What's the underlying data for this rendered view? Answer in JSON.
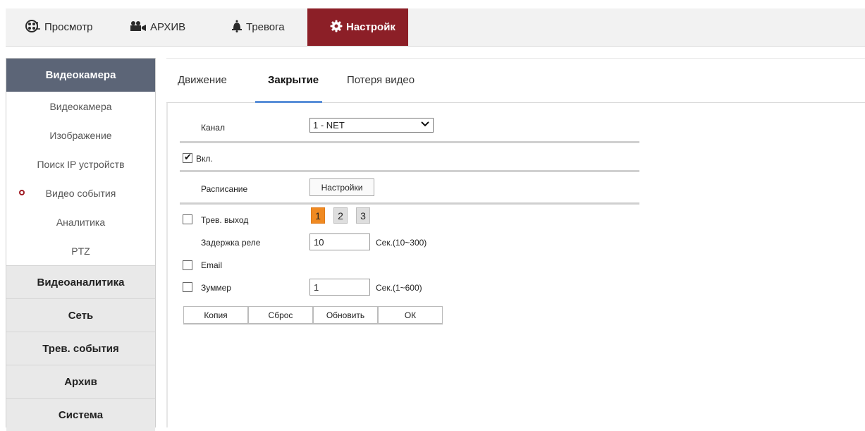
{
  "topnav": {
    "preview": "Просмотр",
    "archive": "АРХИВ",
    "alarm": "Тревога",
    "settings": "Настройк"
  },
  "sidebar": {
    "header": "Видеокамера",
    "items": [
      {
        "label": "Видеокамера"
      },
      {
        "label": "Изображение"
      },
      {
        "label": "Поиск IP устройств"
      },
      {
        "label": "Видео события"
      },
      {
        "label": "Аналитика"
      },
      {
        "label": "PTZ"
      }
    ],
    "sections": [
      {
        "label": "Видеоаналитика"
      },
      {
        "label": "Сеть"
      },
      {
        "label": "Трев. события"
      },
      {
        "label": "Архив"
      },
      {
        "label": "Система"
      }
    ]
  },
  "tabs": {
    "motion": "Движение",
    "cover": "Закрытие",
    "loss": "Потеря видео"
  },
  "form": {
    "channel_label": "Канал",
    "channel_value": "1 - NET",
    "enable_label": "Вкл.",
    "schedule_label": "Расписание",
    "schedule_button": "Настройки",
    "alarm_out_label": "Трев. выход",
    "alarm_out_channels": [
      "1",
      "2",
      "3"
    ],
    "relay_delay_label": "Задержка реле",
    "relay_delay_value": "10",
    "relay_delay_hint": "Сек.(10~300)",
    "email_label": "Email",
    "buzzer_label": "Зуммер",
    "buzzer_value": "1",
    "buzzer_hint": "Сек.(1~600)"
  },
  "actions": {
    "copy": "Копия",
    "reset": "Сброс",
    "refresh": "Обновить",
    "ok": "ОК"
  }
}
